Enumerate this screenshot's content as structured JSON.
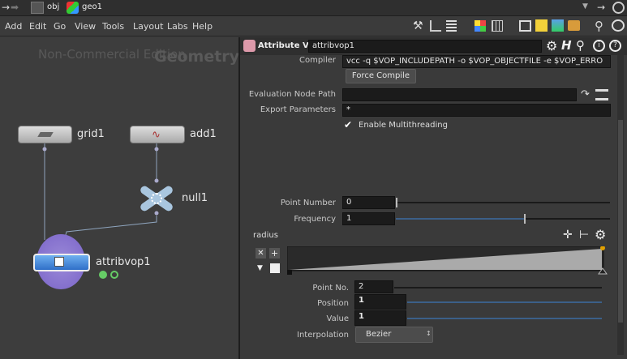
{
  "pathbar": {
    "obj_label": "obj",
    "geo_label": "geo1"
  },
  "menu": [
    "Add",
    "Edit",
    "Go",
    "View",
    "Tools",
    "Layout",
    "Labs",
    "Help"
  ],
  "network": {
    "watermark": "Non-Commercial Edition",
    "context_label": "Geometry",
    "nodes": {
      "grid": "grid1",
      "add": "add1",
      "null": "null1",
      "attribvop": "attribvop1"
    }
  },
  "params": {
    "node_type": "Attribute VOP",
    "node_name": "attribvop1",
    "compiler_label": "Compiler",
    "compiler_value": "vcc -q $VOP_INCLUDEPATH -o $VOP_OBJECTFILE -e $VOP_ERRO",
    "force_compile": "Force Compile",
    "eval_path_label": "Evaluation Node Path",
    "eval_path_value": "",
    "export_label": "Export Parameters",
    "export_value": "*",
    "multithread_label": "Enable Multithreading",
    "point_number_label": "Point Number",
    "point_number_value": "0",
    "point_number_fraction": 0.0,
    "frequency_label": "Frequency",
    "frequency_value": "1",
    "frequency_fraction": 0.6,
    "radius_label": "radius",
    "point_no_label": "Point No.",
    "point_no_value": "2",
    "position_label": "Position",
    "position_value": "1",
    "value_label": "Value",
    "value_value": "1",
    "interp_label": "Interpolation",
    "interp_value": "Bezier"
  },
  "colors": {
    "accent": "#e0a000",
    "slider_fill": "#3b5f88",
    "vop_node": "#3a7fd5"
  }
}
